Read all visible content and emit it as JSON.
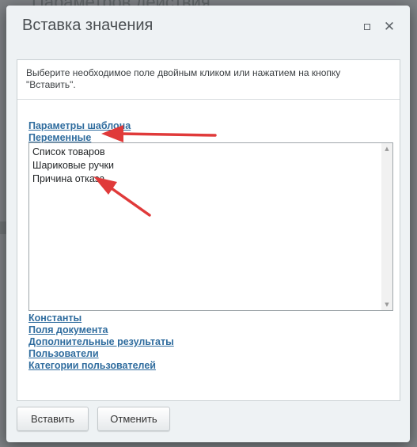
{
  "background": {
    "page_heading_fragment": "Параметров действия"
  },
  "dialog": {
    "title": "Вставка значения",
    "hint_line1": "Выберите необходимое поле двойным кликом или нажатием на кнопку",
    "hint_line2": "\"Вставить\".",
    "links_top": [
      "Параметры шаблона",
      "Переменные"
    ],
    "list_items": [
      "Список товаров",
      "Шариковые ручки",
      "Причина отказа"
    ],
    "links_bottom": [
      "Константы",
      "Поля документа",
      "Дополнительные результаты",
      "Пользователи",
      "Категории пользователей"
    ],
    "buttons": {
      "insert": "Вставить",
      "cancel": "Отменить"
    }
  },
  "icons": {
    "maximize": "maximize-icon",
    "close": "close-icon",
    "scroll_up": "scroll-up-icon",
    "scroll_down": "scroll-down-icon"
  },
  "colors": {
    "link": "#2f6c9e",
    "annotation_arrow": "#e03a3a",
    "overlay": "#7d8184"
  }
}
